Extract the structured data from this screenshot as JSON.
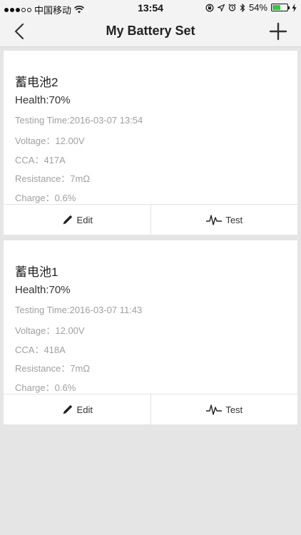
{
  "status": {
    "carrier": "中国移动",
    "time": "13:54",
    "battery_percent": "54%",
    "battery_level": 0.54
  },
  "nav": {
    "title": "My Battery Set",
    "back_icon": "chevron-left-icon",
    "add_icon": "plus-icon"
  },
  "batteries": [
    {
      "name": "蓄电池2",
      "health": "Health:70%",
      "testing_time": "Testing Time:2016-03-07 13:54",
      "voltage": "Voltage：12.00V",
      "cca": "CCA：417A",
      "resistance": "Resistance：7mΩ",
      "charge": "Charge：0.6%",
      "edit_label": "Edit",
      "test_label": "Test"
    },
    {
      "name": "蓄电池1",
      "health": "Health:70%",
      "testing_time": "Testing Time:2016-03-07 11:43",
      "voltage": "Voltage：12.00V",
      "cca": "CCA：418A",
      "resistance": "Resistance：7mΩ",
      "charge": "Charge：0.6%",
      "edit_label": "Edit",
      "test_label": "Test"
    }
  ]
}
